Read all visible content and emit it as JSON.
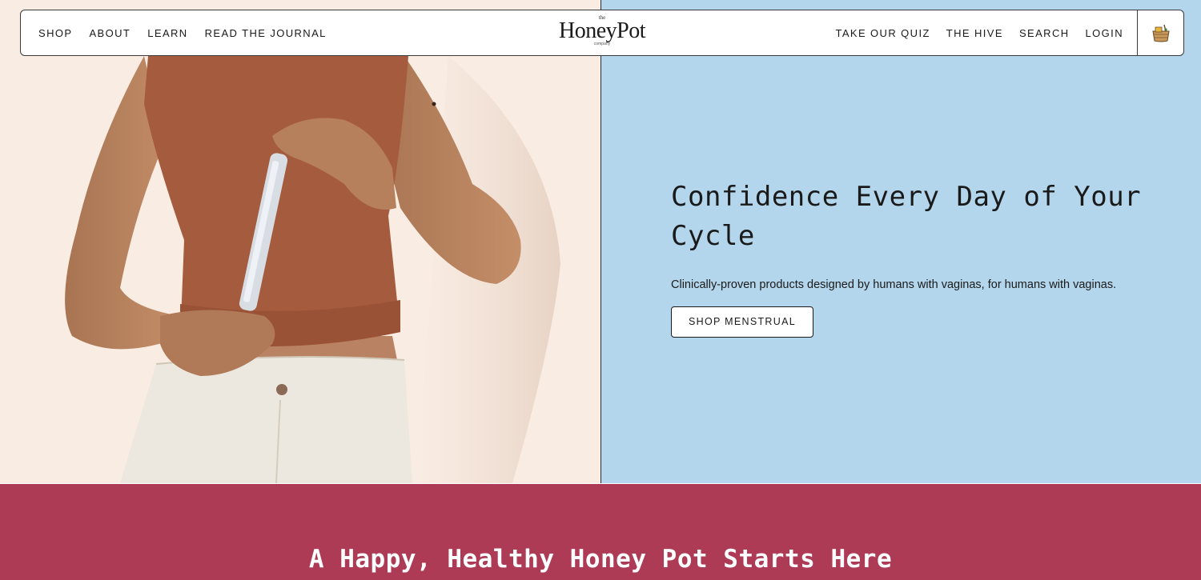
{
  "nav": {
    "left_items": [
      {
        "label": "SHOP"
      },
      {
        "label": "ABOUT"
      },
      {
        "label": "LEARN"
      },
      {
        "label": "READ THE JOURNAL"
      }
    ],
    "logo": {
      "top": "the",
      "name": "HoneyPot",
      "bottom": "company"
    },
    "right_items": [
      {
        "label": "TAKE OUR QUIZ"
      },
      {
        "label": "THE HIVE"
      },
      {
        "label": "SEARCH"
      },
      {
        "label": "LOGIN"
      }
    ],
    "cart_icon": "honey-basket-icon"
  },
  "hero": {
    "image_description": "woman in rust crop top holding tampon",
    "headline": "Confidence Every Day of Your Cycle",
    "subtext": "Clinically-proven products designed by humans with vaginas, for humans with vaginas.",
    "cta_label": "SHOP MENSTRUAL"
  },
  "promo": {
    "title": "A Happy, Healthy Honey Pot Starts Here"
  },
  "colors": {
    "hero_left_bg": "#f9ece3",
    "hero_right_bg": "#b3d6ec",
    "promo_bg": "#ad3b55",
    "top_rust": "#a55b3d"
  }
}
